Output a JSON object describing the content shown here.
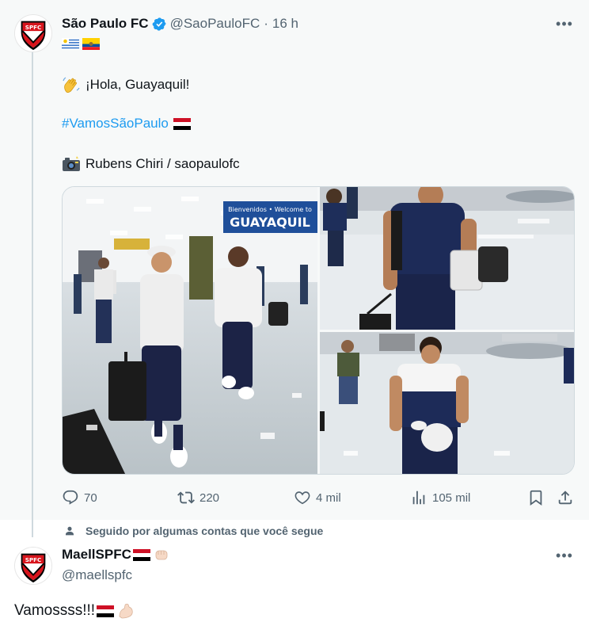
{
  "tweet": {
    "author_name": "São Paulo FC",
    "author_handle": "@SaoPauloFC",
    "separator": "·",
    "time": "16 h",
    "flags": [
      "uruguay-flag",
      "ecuador-flag"
    ],
    "line1_text": "¡Hola, Guayaquil!",
    "line1_emoji": "waving-hand",
    "hashtag": "#VamosSãoPaulo",
    "hashtag_emoji": "yemen-flag",
    "credit_text": "Rubens Chiri / saopaulofc",
    "credit_emoji": "camera-with-flash",
    "media": {
      "photo1_sign": "Bienvenidos • Welcome to",
      "photo1_city": "GUAYAQUIL"
    },
    "actions": {
      "replies": "70",
      "retweets": "220",
      "likes": "4 mil",
      "views": "105 mil"
    }
  },
  "social_context": "Seguido por algumas contas que você segue",
  "reply": {
    "author_name": "MaellSPFC",
    "author_handle": "@maellspfc",
    "text": "Vamossss!!!",
    "name_emojis": [
      "yemen-flag",
      "fist-emoji"
    ],
    "text_emojis": [
      "yemen-flag",
      "flexed-biceps"
    ]
  },
  "colors": {
    "accent": "#1d9bf0",
    "text": "#0f1419",
    "muted": "#536471",
    "club_red": "#d8141c"
  }
}
